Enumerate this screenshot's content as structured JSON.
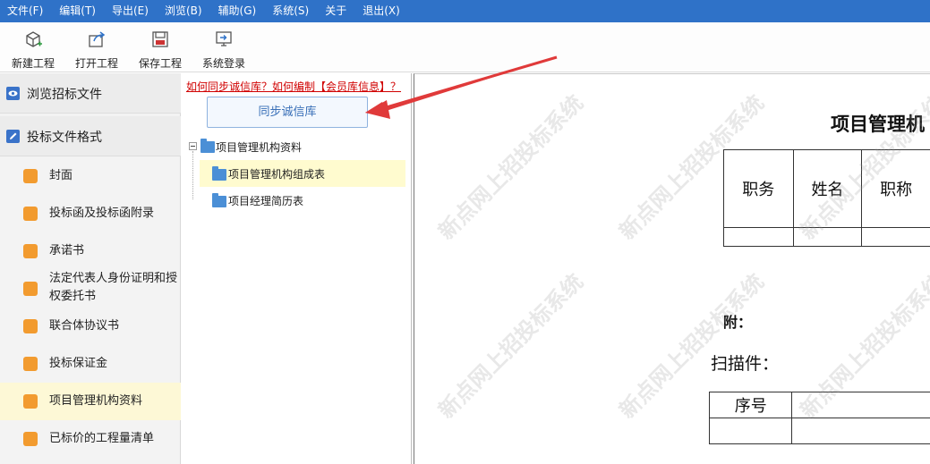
{
  "menu": {
    "items": [
      "文件(F)",
      "编辑(T)",
      "导出(E)",
      "浏览(B)",
      "辅助(G)",
      "系统(S)",
      "关于",
      "退出(X)"
    ]
  },
  "toolbar": {
    "new_project": "新建工程",
    "open_project": "打开工程",
    "save_project": "保存工程",
    "system_login": "系统登录"
  },
  "sidebar": {
    "browse_tender": "浏览招标文件",
    "bid_format": "投标文件格式",
    "items": [
      "封面",
      "投标函及投标函附录",
      "承诺书",
      "法定代表人身份证明和授权委托书",
      "联合体协议书",
      "投标保证金",
      "项目管理机构资料",
      "已标价的工程量清单"
    ],
    "active_index": 6
  },
  "tree_panel": {
    "help_link": "如何同步诚信库？如何编制【会员库信息】？",
    "sync_button": "同步诚信库",
    "root": "项目管理机构资料",
    "children": [
      "项目管理机构组成表",
      "项目经理简历表"
    ],
    "active_child": 0
  },
  "document": {
    "title": "项目管理机",
    "table_headers": [
      "职务",
      "姓名",
      "职称"
    ],
    "attachment_label": "附：",
    "scan_label": "扫描件：",
    "scan_table_header": "序号",
    "watermark": "新点网上招投标系统"
  },
  "colors": {
    "menubar": "#2f72c8",
    "nav_icon": "#f29b2f",
    "active_row": "#fdf8d6",
    "link_red": "#d00000",
    "arrow_red": "#e03a3a"
  }
}
